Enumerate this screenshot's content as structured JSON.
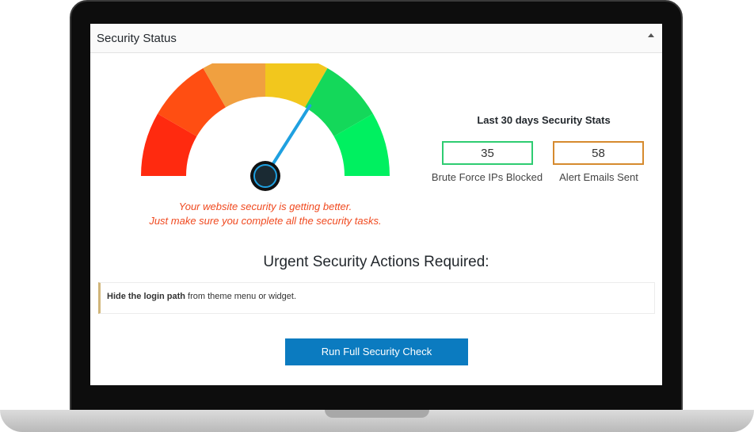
{
  "panel": {
    "title": "Security Status"
  },
  "gauge": {
    "level": 0.68,
    "message_line1": "Your website security is getting better.",
    "message_line2": "Just make sure you complete all the security tasks.",
    "segment_colors": [
      "#ff2a0f",
      "#ff4e12",
      "#f0a040",
      "#f2c71d",
      "#14d85a",
      "#00f060"
    ],
    "needle_color": "#1fa0e0",
    "message_color": "#f0491f"
  },
  "stats": {
    "title": "Last 30 days Security Stats",
    "items": [
      {
        "value": "35",
        "label": "Brute Force IPs Blocked",
        "border_color": "#2ecc71"
      },
      {
        "value": "58",
        "label": "Alert Emails Sent",
        "border_color": "#d68a2e"
      }
    ]
  },
  "urgent": {
    "title": "Urgent Security Actions Required:",
    "actions": [
      {
        "strong": "Hide the login path",
        "rest": " from theme menu or widget."
      }
    ]
  },
  "button": {
    "label": "Run Full Security Check",
    "color": "#0b7bc0"
  }
}
